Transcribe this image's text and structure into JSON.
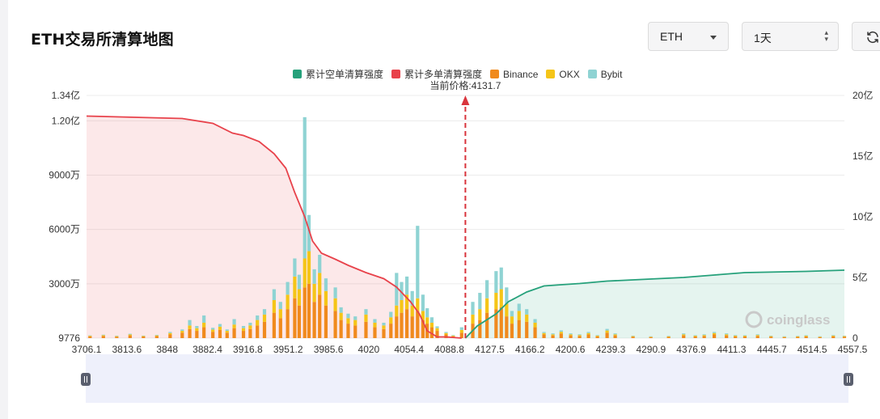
{
  "title": "ETH交易所清算地图",
  "controls": {
    "symbol": "ETH",
    "timeframe": "1天"
  },
  "watermark": "coinglass",
  "colors": {
    "short": "#26a17b",
    "long": "#e8424b",
    "binance": "#f08a1d",
    "okx": "#f5c518",
    "bybit": "#8fd3d3"
  },
  "chart_data": {
    "type": "bar",
    "title": "",
    "current_price_label": "当前价格:4131.7",
    "current_price": 4131.7,
    "legend": [
      {
        "name": "累计空单清算强度",
        "color": "#26a17b"
      },
      {
        "name": "累计多单清算强度",
        "color": "#e8424b"
      },
      {
        "name": "Binance",
        "color": "#f08a1d"
      },
      {
        "name": "OKX",
        "color": "#f5c518"
      },
      {
        "name": "Bybit",
        "color": "#8fd3d3"
      }
    ],
    "x_ticks": [
      "3706.1",
      "3813.6",
      "3848",
      "3882.4",
      "3916.8",
      "3951.2",
      "3985.6",
      "4020",
      "4054.4",
      "4088.8",
      "4127.5",
      "4166.2",
      "4200.6",
      "4239.3",
      "4290.9",
      "4376.9",
      "4411.3",
      "4445.7",
      "4514.5",
      "4557.5"
    ],
    "y_left_ticks": [
      "1.34亿",
      "1.20亿",
      "9000万",
      "6000万",
      "3000万",
      "9776"
    ],
    "y_left_values": [
      134000000,
      120000000,
      90000000,
      60000000,
      30000000,
      9776
    ],
    "y_left_range": [
      9776,
      134000000
    ],
    "y_right_ticks": [
      "20亿",
      "15亿",
      "10亿",
      "5亿",
      "0"
    ],
    "y_right_range": [
      0,
      2000000000
    ],
    "x_range": [
      3706.1,
      4557.5
    ],
    "long_cumulative": {
      "x": [
        3706.1,
        3760,
        3813.6,
        3848,
        3870,
        3882.4,
        3900,
        3916.8,
        3930,
        3940,
        3951.2,
        3960,
        3970,
        3985.6,
        4000,
        4020,
        4040,
        4054.4,
        4070,
        4080,
        4088.8,
        4100,
        4110,
        4127.5
      ],
      "y": [
        1830000000,
        1820000000,
        1810000000,
        1770000000,
        1690000000,
        1670000000,
        1620000000,
        1520000000,
        1400000000,
        1200000000,
        1000000000,
        800000000,
        700000000,
        650000000,
        600000000,
        540000000,
        490000000,
        420000000,
        300000000,
        200000000,
        60000000,
        10000000,
        10000000,
        0
      ]
    },
    "short_cumulative": {
      "x": [
        4131.7,
        4145,
        4166.2,
        4180,
        4200.6,
        4220,
        4239.3,
        4260,
        4290.9,
        4320,
        4376.9,
        4411.3,
        4445.7,
        4514.5,
        4557.5
      ],
      "y": [
        0,
        100000000,
        200000000,
        300000000,
        380000000,
        430000000,
        440000000,
        450000000,
        470000000,
        480000000,
        500000000,
        520000000,
        540000000,
        550000000,
        560000000
      ]
    },
    "bars": {
      "x": [
        3710,
        3725,
        3740,
        3755,
        3770,
        3785,
        3800,
        3813.6,
        3822,
        3830,
        3838,
        3848,
        3856,
        3864,
        3872,
        3882.4,
        3890,
        3898,
        3906,
        3916.8,
        3924,
        3932,
        3940,
        3945,
        3951.2,
        3956,
        3962,
        3968,
        3975,
        3985.6,
        3992,
        4000,
        4008,
        4020,
        4030,
        4040,
        4048,
        4054.4,
        4060,
        4066,
        4072,
        4078,
        4084,
        4088.8,
        4094,
        4100,
        4110,
        4118,
        4127.5,
        4140,
        4148,
        4156,
        4166.2,
        4172,
        4178,
        4184,
        4192,
        4200.6,
        4210,
        4220,
        4230,
        4239.3,
        4250,
        4260,
        4270,
        4280,
        4290.9,
        4300,
        4320,
        4340,
        4360,
        4376.9,
        4390,
        4400,
        4411.3,
        4425,
        4435,
        4445.7,
        4460,
        4475,
        4490,
        4505,
        4514.5,
        4530,
        4545,
        4557.5
      ],
      "binance": [
        1000000,
        1200000,
        800000,
        1500000,
        900000,
        1100000,
        2000000,
        3000000,
        5000000,
        4000000,
        6000000,
        3500000,
        4500000,
        3000000,
        5500000,
        4000000,
        5000000,
        7000000,
        9000000,
        14000000,
        11000000,
        16000000,
        22000000,
        18000000,
        28000000,
        30000000,
        20000000,
        24000000,
        18000000,
        15000000,
        10000000,
        8000000,
        7000000,
        9000000,
        6000000,
        5000000,
        8000000,
        12000000,
        14000000,
        16000000,
        12000000,
        15000000,
        10000000,
        8000000,
        6000000,
        4000000,
        2000000,
        1000000,
        3000000,
        8000000,
        10000000,
        14000000,
        16000000,
        17000000,
        12000000,
        8000000,
        10000000,
        9000000,
        6000000,
        2000000,
        1500000,
        2500000,
        1500000,
        1200000,
        2000000,
        1000000,
        3000000,
        1500000,
        800000,
        600000,
        700000,
        1500000,
        900000,
        1200000,
        2000000,
        1500000,
        1000000,
        900000,
        1200000,
        800000,
        600000,
        700000,
        900000,
        600000,
        1000000,
        800000
      ],
      "okx": [
        300000,
        400000,
        300000,
        500000,
        300000,
        400000,
        800000,
        1000000,
        2000000,
        1500000,
        2500000,
        1200000,
        1800000,
        1000000,
        2000000,
        1500000,
        2000000,
        3000000,
        4000000,
        7000000,
        5000000,
        8000000,
        12000000,
        9000000,
        16000000,
        18000000,
        10000000,
        12000000,
        8000000,
        7000000,
        4000000,
        3000000,
        3000000,
        4000000,
        2500000,
        2000000,
        3500000,
        6000000,
        7000000,
        8000000,
        6000000,
        7000000,
        5000000,
        3500000,
        2500000,
        1500000,
        800000,
        400000,
        1500000,
        5000000,
        6000000,
        8000000,
        9000000,
        10000000,
        7000000,
        4000000,
        5000000,
        4000000,
        2500000,
        800000,
        600000,
        1000000,
        600000,
        500000,
        800000,
        400000,
        1200000,
        600000,
        300000,
        200000,
        300000,
        600000,
        400000,
        500000,
        800000,
        600000,
        400000,
        400000,
        500000,
        300000,
        200000,
        300000,
        400000,
        200000,
        400000,
        300000
      ],
      "bybit": [
        200000,
        300000,
        200000,
        400000,
        200000,
        300000,
        600000,
        800000,
        3000000,
        1200000,
        4000000,
        1000000,
        1500000,
        800000,
        3000000,
        1200000,
        1500000,
        2500000,
        3000000,
        6000000,
        4000000,
        7000000,
        10000000,
        8000000,
        78000000,
        20000000,
        8000000,
        10000000,
        7000000,
        6000000,
        3000000,
        2500000,
        2000000,
        3000000,
        2000000,
        1500000,
        3000000,
        18000000,
        10000000,
        10000000,
        8000000,
        40000000,
        9000000,
        5000000,
        3000000,
        1000000,
        600000,
        300000,
        1500000,
        7000000,
        9000000,
        10000000,
        12000000,
        12000000,
        9000000,
        3000000,
        4000000,
        3000000,
        2000000,
        600000,
        500000,
        800000,
        500000,
        400000,
        600000,
        300000,
        900000,
        500000,
        200000,
        200000,
        200000,
        500000,
        300000,
        400000,
        600000,
        500000,
        300000,
        300000,
        400000,
        200000,
        200000,
        200000,
        300000,
        200000,
        300000,
        200000
      ]
    }
  }
}
